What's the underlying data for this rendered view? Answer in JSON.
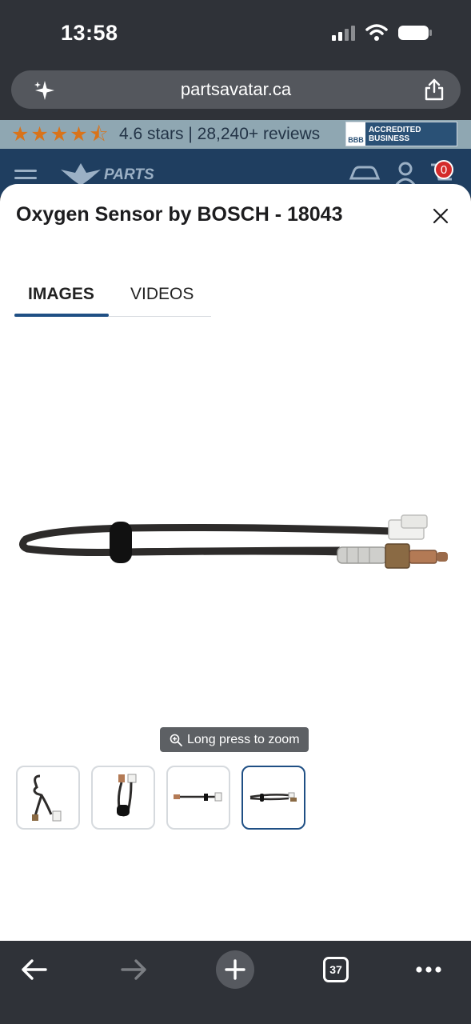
{
  "status_bar": {
    "time": "13:58"
  },
  "browser": {
    "url": "partsavatar.ca",
    "tab_count": "37"
  },
  "site": {
    "rating_text": "4.6 stars | 28,240+ reviews",
    "bbb_badge": "ACCREDITED BUSINESS",
    "bbb_logo": "BBB",
    "logo_text": "PARTS",
    "cart_count": "0"
  },
  "modal": {
    "title": "Oxygen Sensor by BOSCH - 18043",
    "tabs": [
      {
        "label": "IMAGES",
        "active": true
      },
      {
        "label": "VIDEOS",
        "active": false
      }
    ],
    "zoom_hint": "Long press to zoom",
    "thumbnails_selected": 4
  },
  "colors": {
    "accent": "#1f4f84",
    "site_nav": "#1f3e60",
    "rating_bar": "#8fa7b2",
    "star": "#d9731a",
    "cart_badge": "#d42b2b"
  }
}
